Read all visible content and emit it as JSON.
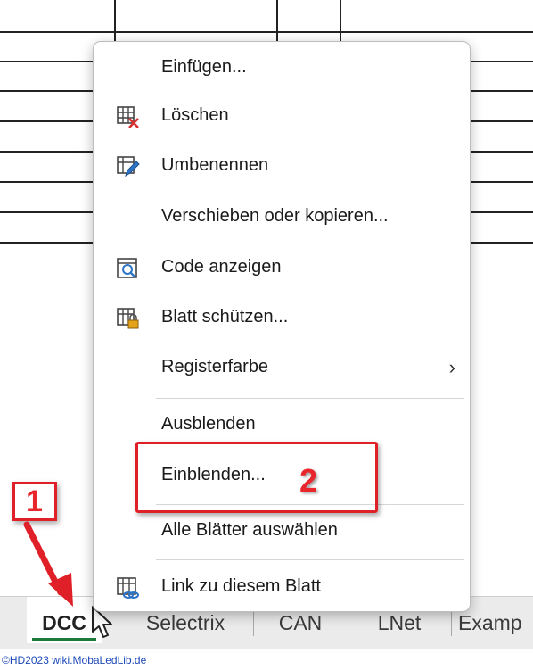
{
  "context_menu": {
    "items": [
      {
        "label": "Einfügen...",
        "icon": ""
      },
      {
        "label": "Löschen",
        "icon": "delete-sheet-icon"
      },
      {
        "label": "Umbenennen",
        "icon": "rename-sheet-icon"
      },
      {
        "label": "Verschieben oder kopieren...",
        "icon": ""
      },
      {
        "label": "Code anzeigen",
        "icon": "view-code-icon"
      },
      {
        "label": "Blatt schützen...",
        "icon": "protect-sheet-icon"
      },
      {
        "label": "Registerfarbe",
        "icon": "",
        "submenu_arrow": "›"
      },
      {
        "label": "Ausblenden",
        "icon": ""
      },
      {
        "label": "Einblenden...",
        "icon": ""
      },
      {
        "label": "Alle Blätter auswählen",
        "icon": ""
      },
      {
        "label": "Link zu diesem Blatt",
        "icon": "link-sheet-icon"
      }
    ]
  },
  "sheet_tabs": [
    {
      "label": "DCC",
      "active": true
    },
    {
      "label": "Selectrix",
      "active": false
    },
    {
      "label": "CAN",
      "active": false
    },
    {
      "label": "LNet",
      "active": false
    },
    {
      "label": "Examp",
      "active": false
    }
  ],
  "annotations": {
    "step1": "1",
    "step2": "2",
    "color": "#e02028"
  },
  "footer_credit": "©HD2023 wiki.MobaLedLib.de",
  "colors": {
    "active_tab_underline": "#1d7a3a",
    "menu_border": "#bdbdbd",
    "tabbar_bg": "#ebebeb"
  }
}
